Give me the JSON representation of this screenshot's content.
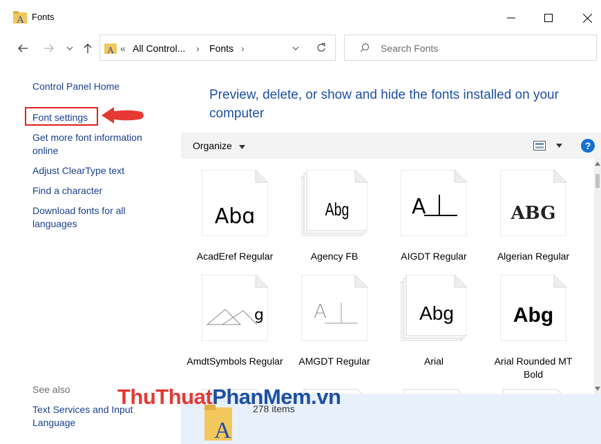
{
  "window": {
    "title": "Fonts"
  },
  "address": {
    "crumb_sep": "«",
    "crumb1": "All Control...",
    "arrow1": "›",
    "crumb2": "Fonts",
    "arrow2": "›"
  },
  "search": {
    "placeholder": "Search Fonts"
  },
  "sidebar": {
    "home": "Control Panel Home",
    "font_settings": "Font settings",
    "more_info": "Get more font information online",
    "cleartype": "Adjust ClearType text",
    "find_char": "Find a character",
    "download": "Download fonts for all languages",
    "see_also": "See also",
    "text_services": "Text Services and Input Language"
  },
  "main": {
    "headline": "Preview, delete, or show and hide the fonts installed on your computer",
    "organize": "Organize",
    "help_icon": "?",
    "status": "278 items"
  },
  "fonts": [
    {
      "name": "AcadEref Regular",
      "sample": "Abɑ"
    },
    {
      "name": "Agency FB",
      "sample": "Abg"
    },
    {
      "name": "AIGDT Regular",
      "sample": "A⊥"
    },
    {
      "name": "Algerian Regular",
      "sample": "ABG"
    },
    {
      "name": "AmdtSymbols Regular",
      "sample": "g"
    },
    {
      "name": "AMGDT Regular",
      "sample": "A⊥"
    },
    {
      "name": "Arial",
      "sample": "Abg"
    },
    {
      "name": "Arial Rounded MT Bold",
      "sample": "Abg"
    }
  ],
  "watermark": {
    "part1": "ThuThuat",
    "part2": "PhanMem",
    "part3": ".vn"
  },
  "colors": {
    "link": "#1a3f8f",
    "headline": "#1e4fa3",
    "highlight": "#e02020",
    "status_bg": "#e8f1fb"
  }
}
